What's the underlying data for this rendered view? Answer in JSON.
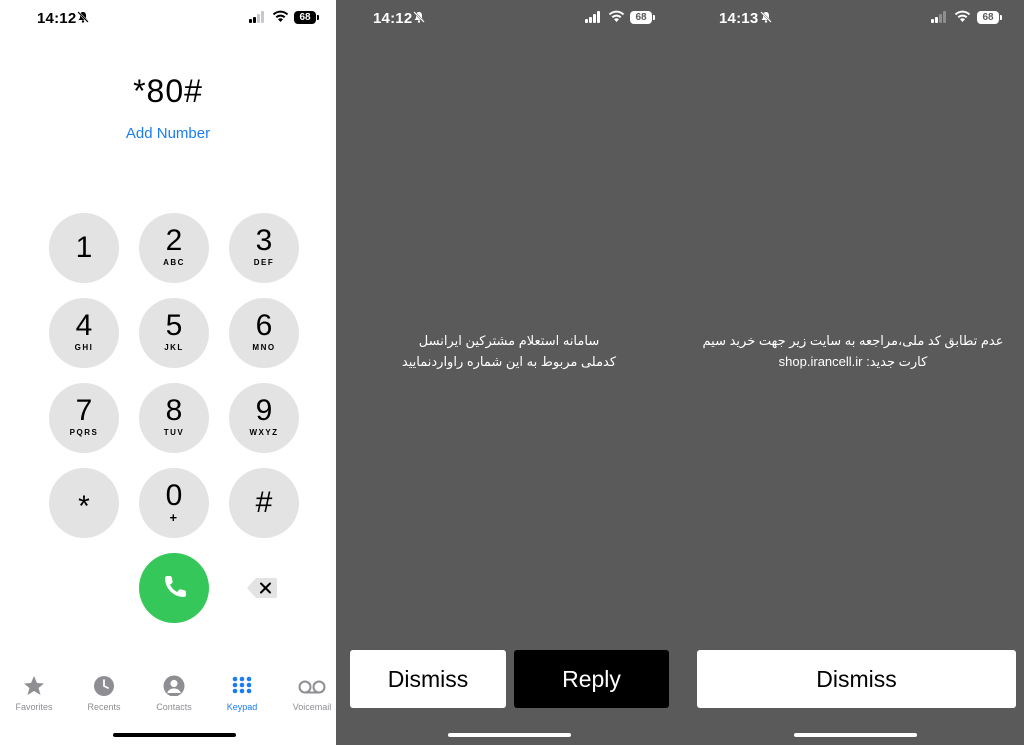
{
  "screen1": {
    "status": {
      "time": "14:12",
      "battery": "68"
    },
    "dialed": "*80#",
    "add_number": "Add Number",
    "keys": [
      {
        "digit": "1",
        "letters": ""
      },
      {
        "digit": "2",
        "letters": "ABC"
      },
      {
        "digit": "3",
        "letters": "DEF"
      },
      {
        "digit": "4",
        "letters": "GHI"
      },
      {
        "digit": "5",
        "letters": "JKL"
      },
      {
        "digit": "6",
        "letters": "MNO"
      },
      {
        "digit": "7",
        "letters": "PQRS"
      },
      {
        "digit": "8",
        "letters": "TUV"
      },
      {
        "digit": "9",
        "letters": "WXYZ"
      },
      {
        "digit": "*",
        "letters": ""
      },
      {
        "digit": "0",
        "letters": "+"
      },
      {
        "digit": "#",
        "letters": ""
      }
    ],
    "tabs": [
      {
        "label": "Favorites",
        "icon": "star-icon"
      },
      {
        "label": "Recents",
        "icon": "clock-icon"
      },
      {
        "label": "Contacts",
        "icon": "person-icon"
      },
      {
        "label": "Keypad",
        "icon": "keypad-icon",
        "active": true
      },
      {
        "label": "Voicemail",
        "icon": "voicemail-icon"
      }
    ],
    "colors": {
      "accent": "#1b7cf2",
      "call": "#35c759",
      "key": "#e3e3e3"
    }
  },
  "screen2": {
    "status": {
      "time": "14:12",
      "battery": "68"
    },
    "message_line1": "سامانه استعلام مشترکین ایرانسل",
    "message_line2": "کدملی مربوط به این شماره راواردنمایید",
    "dismiss_label": "Dismiss",
    "reply_label": "Reply"
  },
  "screen3": {
    "status": {
      "time": "14:13",
      "battery": "68"
    },
    "message_line1": "عدم تطابق کد ملی،مراجعه به سایت زیر جهت خرید سیم",
    "message_line2": "کارت جدید: shop.irancell.ir",
    "dismiss_label": "Dismiss"
  }
}
